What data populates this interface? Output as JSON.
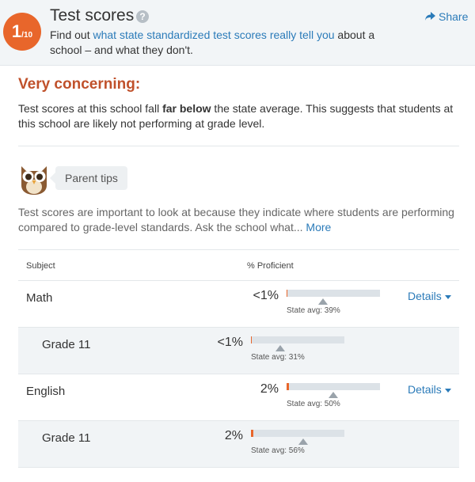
{
  "header": {
    "rating_number": "1",
    "rating_denominator": "/10",
    "title": "Test scores",
    "help_icon": "question-circle-icon",
    "subtitle_prefix": "Find out ",
    "subtitle_link": "what state standardized test scores really tell you",
    "subtitle_suffix": " about a school – and what they don't.",
    "share_label": "Share",
    "share_icon": "share-arrow-icon"
  },
  "rating": {
    "label": "Very concerning:",
    "desc_prefix": "Test scores at this school fall ",
    "desc_bold": "far below",
    "desc_suffix": " the state average. This suggests that students at this school are likely not performing at grade level."
  },
  "tips": {
    "icon": "owl-icon",
    "title": "Parent tips",
    "text": "Test scores are important to look at because they indicate where students are performing compared to grade-level standards. Ask the school what...",
    "more_label": "More"
  },
  "table": {
    "col_subject": "Subject",
    "col_proficient": "% Proficient",
    "rows": [
      {
        "label": "Math",
        "pct": "<1%",
        "value": 0.5,
        "state_avg_label": "State avg: 39%",
        "state_avg": 39,
        "details": "Details",
        "sub": false
      },
      {
        "label": "Grade 11",
        "pct": "<1%",
        "value": 0.5,
        "state_avg_label": "State avg: 31%",
        "state_avg": 31,
        "sub": true
      },
      {
        "label": "English",
        "pct": "2%",
        "value": 2,
        "state_avg_label": "State avg: 50%",
        "state_avg": 50,
        "details": "Details",
        "sub": false
      },
      {
        "label": "Grade 11",
        "pct": "2%",
        "value": 2,
        "state_avg_label": "State avg: 56%",
        "state_avg": 56,
        "sub": true
      }
    ]
  },
  "colors": {
    "accent": "#e8662b",
    "link": "#2b7bb9",
    "warning": "#c0512b"
  }
}
